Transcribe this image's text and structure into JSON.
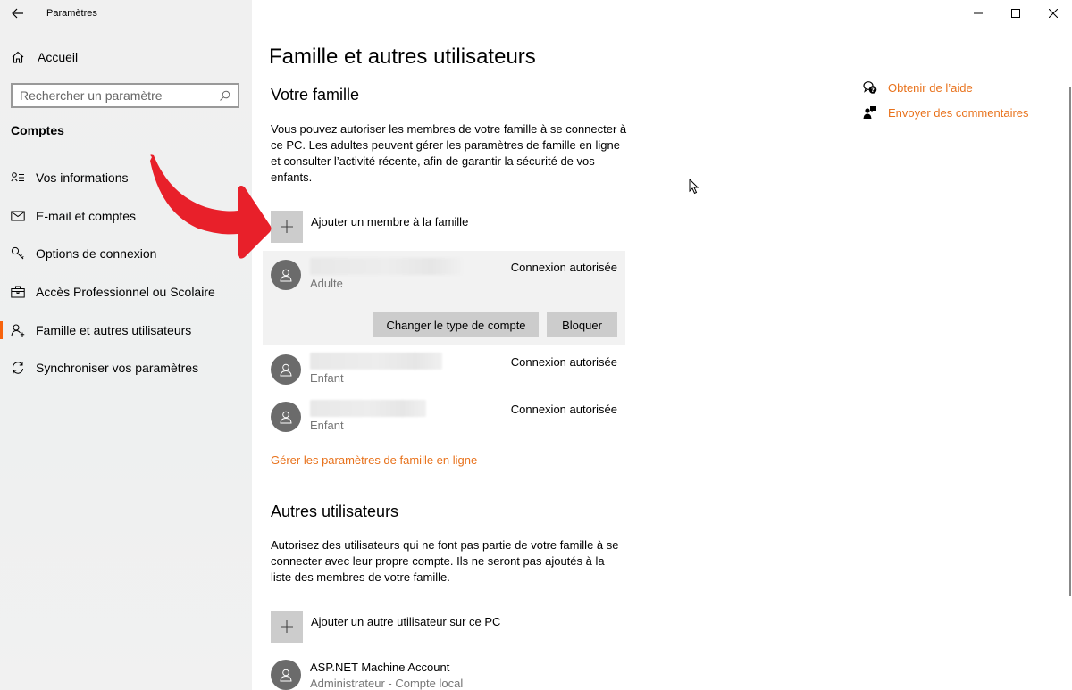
{
  "window": {
    "app_title": "Paramètres",
    "controls": [
      "minimize-icon",
      "maximize-icon",
      "close-icon"
    ]
  },
  "sidebar": {
    "home_label": "Accueil",
    "search_placeholder": "Rechercher un paramètre",
    "search_value": "",
    "section_label": "Comptes",
    "items": [
      {
        "label": "Vos informations",
        "icon": "person-info-icon",
        "active": false
      },
      {
        "label": "E-mail et comptes",
        "icon": "mail-icon",
        "active": false
      },
      {
        "label": "Options de connexion",
        "icon": "key-icon",
        "active": false
      },
      {
        "label": "Accès Professionnel ou Scolaire",
        "icon": "briefcase-icon",
        "active": false
      },
      {
        "label": "Famille et autres utilisateurs",
        "icon": "add-person-icon",
        "active": true
      },
      {
        "label": "Synchroniser vos paramètres",
        "icon": "sync-icon",
        "active": false
      }
    ]
  },
  "main": {
    "title": "Famille et autres utilisateurs",
    "family": {
      "heading": "Votre famille",
      "description": "Vous pouvez autoriser les membres de votre famille à se connecter à ce PC. Les adultes peuvent gérer les paramètres de famille en ligne et consulter l’activité récente, afin de garantir la sécurité de vos enfants.",
      "add_label": "Ajouter un membre à la famille",
      "members": [
        {
          "role": "Adulte",
          "status": "Connexion autorisée",
          "expanded": true
        },
        {
          "role": "Enfant",
          "status": "Connexion autorisée",
          "expanded": false
        },
        {
          "role": "Enfant",
          "status": "Connexion autorisée",
          "expanded": false
        }
      ],
      "change_type_label": "Changer le type de compte",
      "block_label": "Bloquer",
      "manage_link": "Gérer les paramètres de famille en ligne"
    },
    "others": {
      "heading": "Autres utilisateurs",
      "description": "Autorisez des utilisateurs qui ne font pas partie de votre famille à se connecter avec leur propre compte. Ils ne seront pas ajoutés à la liste des membres de votre famille.",
      "add_label": "Ajouter un autre utilisateur sur ce PC",
      "users": [
        {
          "name": "ASP.NET Machine Account",
          "role": "Administrateur - Compte local"
        }
      ]
    },
    "aside": {
      "help_label": "Obtenir de l’aide",
      "feedback_label": "Envoyer des commentaires"
    }
  },
  "colors": {
    "accent": "#f7630c",
    "link": "#e8721c",
    "annotation_arrow": "#e8202a"
  }
}
